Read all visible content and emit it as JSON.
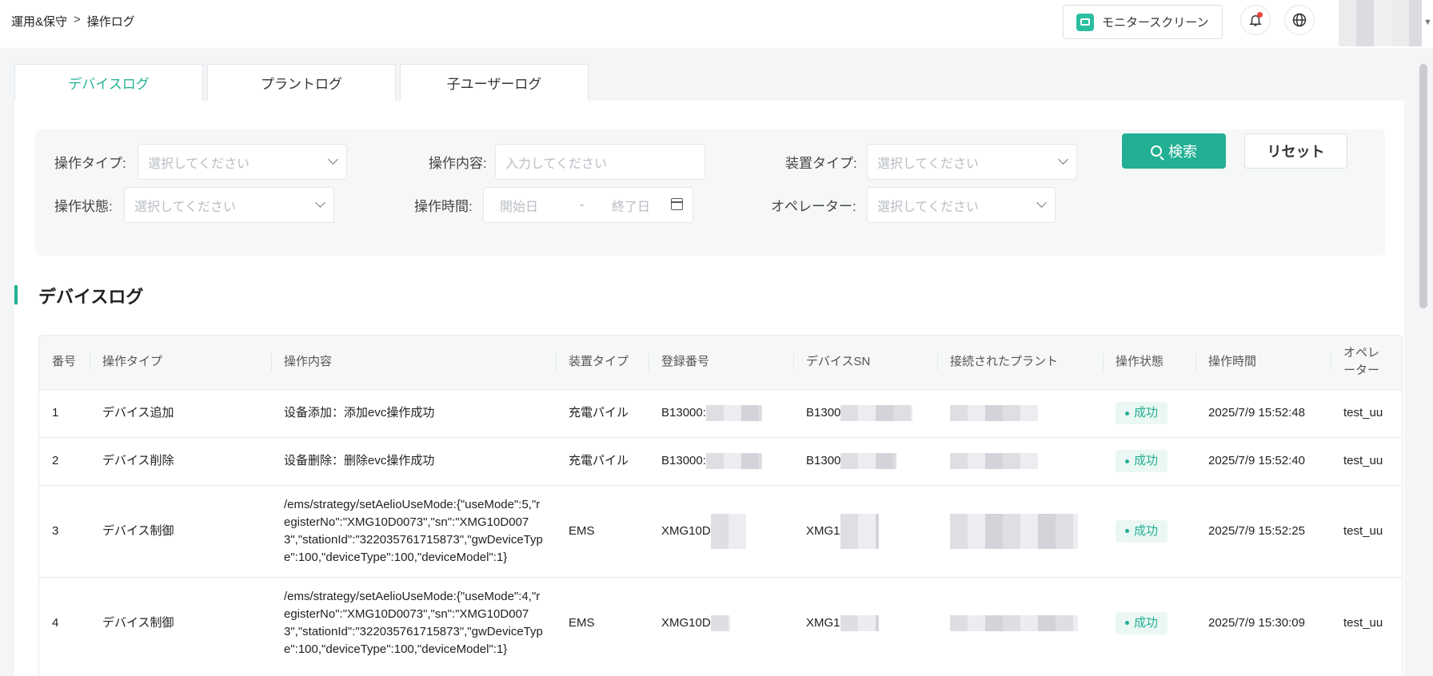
{
  "breadcrumb": {
    "root": "運用&保守",
    "separator": ">",
    "current": "操作ログ"
  },
  "header": {
    "monitor_label": "モニタースクリーン"
  },
  "tabs": [
    {
      "label": "デバイスログ",
      "active": true
    },
    {
      "label": "プラントログ",
      "active": false
    },
    {
      "label": "子ユーザーログ",
      "active": false
    }
  ],
  "filters": {
    "op_type": {
      "label": "操作タイプ:",
      "placeholder": "選択してください"
    },
    "op_content": {
      "label": "操作内容:",
      "placeholder": "入力してください"
    },
    "device_type": {
      "label": "装置タイプ:",
      "placeholder": "選択してください"
    },
    "op_status": {
      "label": "操作状態:",
      "placeholder": "選択してください"
    },
    "op_time": {
      "label": "操作時間:",
      "start_placeholder": "開始日",
      "dash": "-",
      "end_placeholder": "終了日"
    },
    "operator": {
      "label": "オペレーター:",
      "placeholder": "選択してください"
    },
    "search_label": "検索",
    "reset_label": "リセット"
  },
  "section_title": "デバイスログ",
  "table": {
    "headers": [
      "番号",
      "操作タイプ",
      "操作内容",
      "装置タイプ",
      "登録番号",
      "デバイスSN",
      "接続されたプラント",
      "操作状態",
      "操作時間",
      "オペレーター"
    ],
    "rows": [
      {
        "no": "1",
        "type": "デバイス追加",
        "content": "设备添加：添加evc操作成功",
        "device_type": "充電パイル",
        "reg_no": "B13000:",
        "sn": "B1300",
        "status": "成功",
        "time": "2025/7/9 15:52:48",
        "operator": "test_uu"
      },
      {
        "no": "2",
        "type": "デバイス削除",
        "content": "设备删除：删除evc操作成功",
        "device_type": "充電パイル",
        "reg_no": "B13000:",
        "sn": "B1300",
        "status": "成功",
        "time": "2025/7/9 15:52:40",
        "operator": "test_uu"
      },
      {
        "no": "3",
        "type": "デバイス制御",
        "content": "/ems/strategy/setAelioUseMode:{\"useMode\":5,\"registerNo\":\"XMG10D0073\",\"sn\":\"XMG10D0073\",\"stationId\":\"322035761715873\",\"gwDeviceType\":100,\"deviceType\":100,\"deviceModel\":1}",
        "device_type": "EMS",
        "reg_no": "XMG10D",
        "sn": "XMG1",
        "status": "成功",
        "time": "2025/7/9 15:52:25",
        "operator": "test_uu"
      },
      {
        "no": "4",
        "type": "デバイス制御",
        "content": "/ems/strategy/setAelioUseMode:{\"useMode\":4,\"registerNo\":\"XMG10D0073\",\"sn\":\"XMG10D0073\",\"stationId\":\"322035761715873\",\"gwDeviceType\":100,\"deviceType\":100,\"deviceModel\":1}",
        "device_type": "EMS",
        "reg_no": "XMG10D",
        "sn": "XMG1",
        "status": "成功",
        "time": "2025/7/9 15:30:09",
        "operator": "test_uu"
      }
    ]
  },
  "colors": {
    "accent": "#22af93",
    "badge_bg": "#eaf7f3",
    "notification": "#f0443a"
  },
  "icons": [
    "monitor-icon",
    "bell-icon",
    "globe-icon",
    "chevron-down-icon",
    "calendar-icon",
    "search-icon"
  ]
}
